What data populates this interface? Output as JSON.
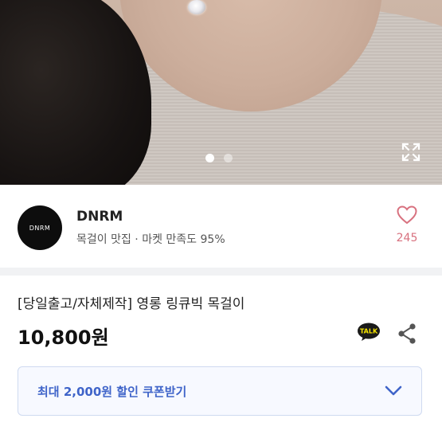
{
  "gallery": {
    "page_count": 2,
    "active_index": 0
  },
  "seller": {
    "avatar_text": "DNRM",
    "name": "DNRM",
    "subtitle": "목걸이 맛집 · 마켓 만족도 95%",
    "like_count": "245"
  },
  "product": {
    "title": "[당일출고/자체제작] 영롱 링큐빅 목걸이",
    "price": "10,800원",
    "talk_badge": "TALK"
  },
  "coupon": {
    "label": "최대 2,000원 할인 쿠폰받기"
  },
  "colors": {
    "like": "#d8717f",
    "coupon_text": "#3f64c9",
    "coupon_border": "#cfdaf0"
  },
  "icons": [
    "expand-icon",
    "heart-icon",
    "kakao-talk-icon",
    "share-icon",
    "chevron-down-icon"
  ]
}
